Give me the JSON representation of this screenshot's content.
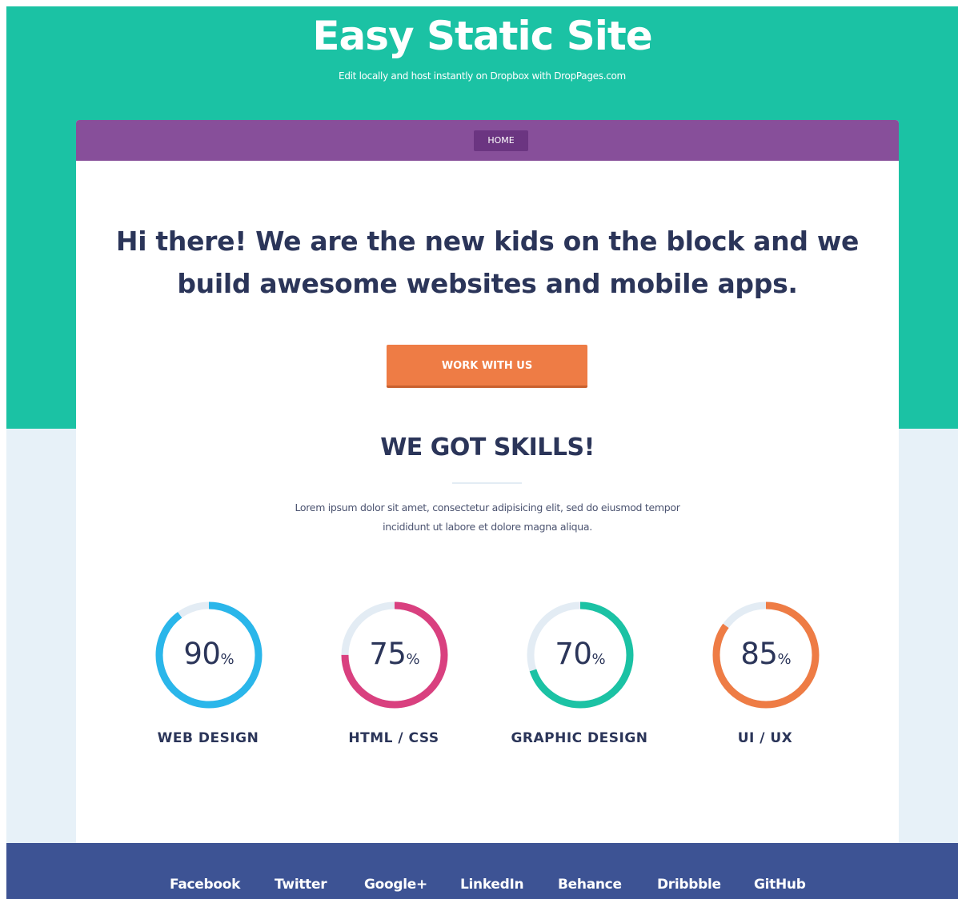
{
  "header": {
    "title": "Easy Static Site",
    "tagline": "Edit locally and host instantly on Dropbox with DropPages.com"
  },
  "nav": {
    "items": [
      {
        "label": "HOME"
      }
    ]
  },
  "hero": {
    "headline": "Hi there! We are the new kids on the block and we build awesome websites and mobile apps.",
    "cta_label": "WORK WITH US"
  },
  "skills": {
    "title": "WE GOT SKILLS!",
    "description": "Lorem ipsum dolor sit amet, consectetur adipisicing elit, sed do eiusmod tempor incididunt ut labore et dolore magna aliqua.",
    "percent_symbol": "%",
    "items": [
      {
        "label": "WEB DESIGN",
        "value": "90",
        "color": "#2ab6ea"
      },
      {
        "label": "HTML / CSS",
        "value": "75",
        "color": "#d9407f"
      },
      {
        "label": "GRAPHIC DESIGN",
        "value": "70",
        "color": "#1bc2a4"
      },
      {
        "label": "UI / UX",
        "value": "85",
        "color": "#ee7c45"
      }
    ],
    "track_color": "#e3ecf4"
  },
  "footer": {
    "links": [
      {
        "label": "Facebook"
      },
      {
        "label": "Twitter"
      },
      {
        "label": "Google+"
      },
      {
        "label": "LinkedIn"
      },
      {
        "label": "Behance"
      },
      {
        "label": "Dribbble"
      },
      {
        "label": "GitHub"
      }
    ]
  },
  "colors": {
    "hero_bg": "#1bc2a4",
    "nav_bg": "#874f9a",
    "nav_active": "#6b3581",
    "cta": "#ee7c45",
    "heading": "#2b3559",
    "footer_bg": "#3d5394",
    "page_bg": "#e7f1f8"
  }
}
